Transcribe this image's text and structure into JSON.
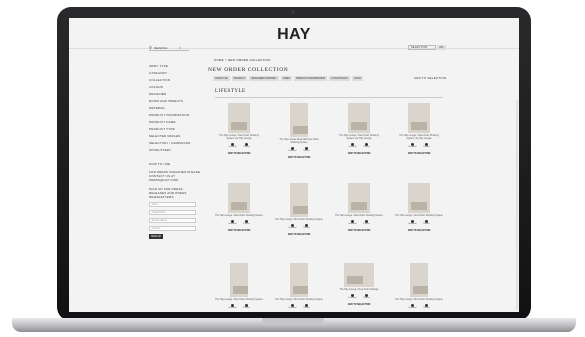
{
  "site": {
    "logo": "HAY"
  },
  "search": {
    "label": "SEARCH"
  },
  "selection": {
    "label": "SELECTION",
    "button": "OK"
  },
  "sidebar": {
    "items": [
      "ARMY TYPE",
      "CATEGORY",
      "COLLECTION",
      "COLOUR",
      "DESIGNER",
      "ROOM AND OBJECTS",
      "MATERIAL",
      "PRODUCT INFORMATION",
      "PRODUCT NAME",
      "PRODUCT TYPE",
      "SELECTED IMAGES",
      "SELECTION / CAMPAIGNS",
      "UPHOLSTERY"
    ],
    "how_to_use": "HOW TO USE",
    "press_contact": "FOR PRESS INQUIRIES PLEASE CONTACT US AT PRESS@HAY.COM",
    "signup_heading": "SIGN UP FOR PRESS RELEASES AND PRESS NEWSLETTERS",
    "fields": [
      "Name",
      "Organization",
      "Email address",
      "Country"
    ],
    "signup_button": "SIGN UP"
  },
  "breadcrumb": "HOME > NEW ORDER COLLECTION",
  "page_title": "NEW ORDER COLLECTION",
  "add_to_selection_top": "ADD TO SELECTION",
  "filters": [
    "LIFESTYLE",
    "PRODUCT",
    "DESIGNER PORTRAIT",
    "VIDEO",
    "PRODUCT INFORMATION",
    "CUTOUTS ETC",
    "LOGO"
  ],
  "section_title": "LIFESTYLE",
  "actions": {
    "a": "Download",
    "b": "Preview"
  },
  "add_to_selection": "ADD TO SELECTION",
  "cards": [
    {
      "caption": "The Hay Lounge / New Order Shelving System, the Hay Lounge"
    },
    {
      "caption": "The Hay Lounge Desk with New Order Shelving System"
    },
    {
      "caption": "The Hay Lounge / New Order Shelving System, the Hay Lounge"
    },
    {
      "caption": "The Hay Lounge / New Order Shelving System, the Hay Lounge"
    },
    {
      "caption": "The Hay Lounge / New Order Shelving System"
    },
    {
      "caption": "The Hay Lounge / New Order Shelving System"
    },
    {
      "caption": "The Hay Lounge / New Order Shelving System"
    },
    {
      "caption": "The Hay Lounge / New Order Shelving System"
    },
    {
      "caption": "The Hay Lounge / New Order Shelving System"
    },
    {
      "caption": "The Hay Lounge / New Order Shelving System"
    },
    {
      "caption": "The Hay Lounge / New Order Storage"
    },
    {
      "caption": "The Hay Lounge / New Order Shelving System"
    }
  ]
}
